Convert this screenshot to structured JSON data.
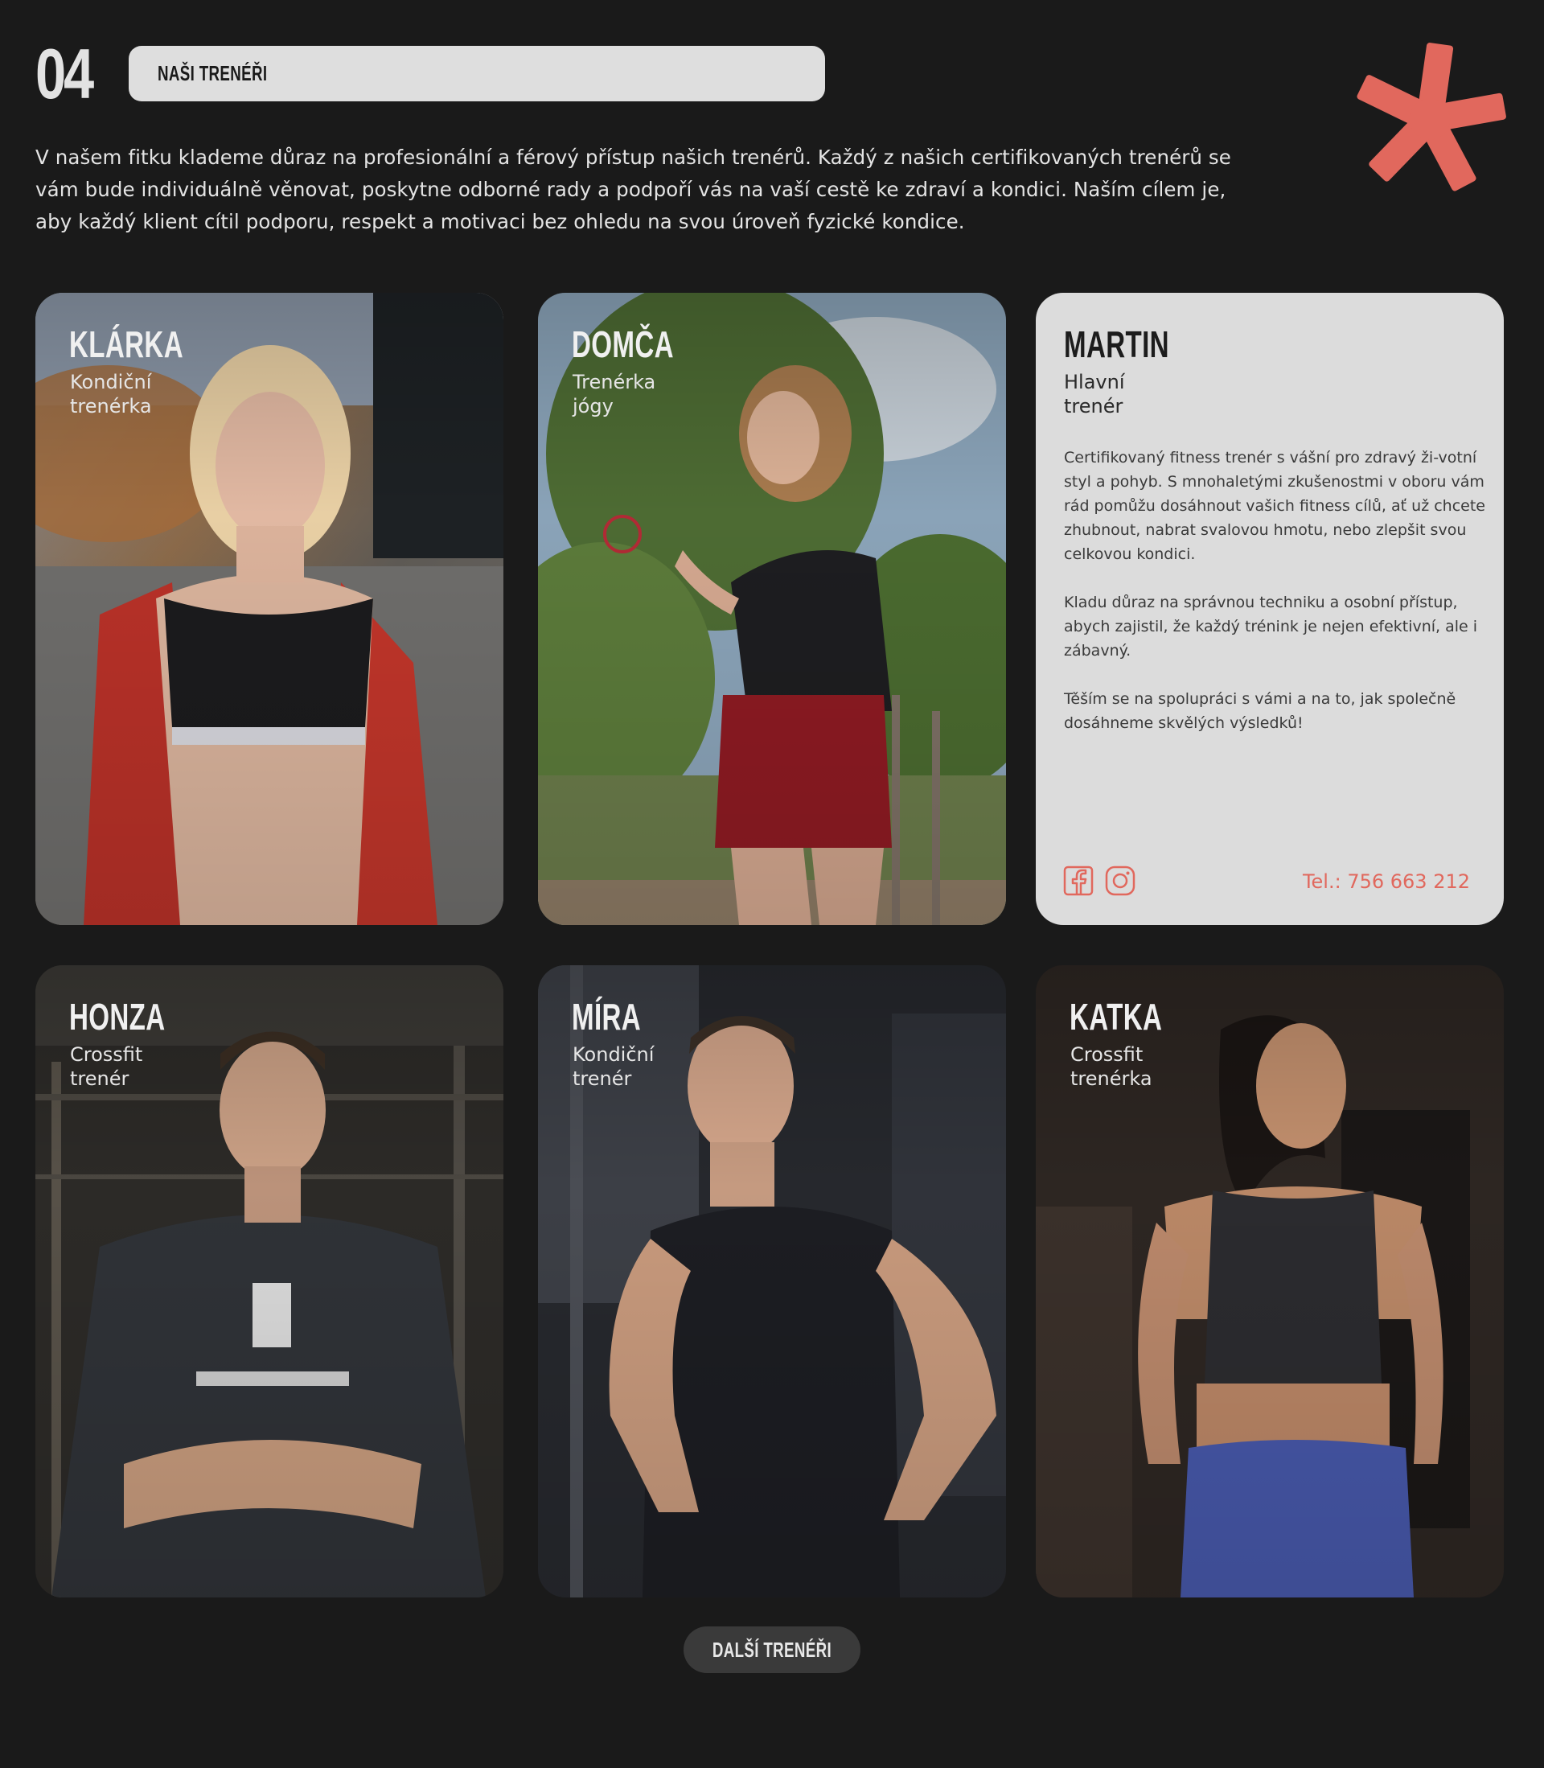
{
  "section": {
    "number": "04",
    "title": "NAŠI TRENÉŘI",
    "intro": "V našem fitku klademe důraz na profesionální a férový přístup našich trenérů. Každý z našich certifikovaných trenérů se vám bude individuálně věnovat, poskytne odborné rady a podpoří vás na vaší cestě ke zdraví a kondici. Naším cílem je, aby každý klient cítil podporu, respekt a motivaci bez ohledu na svou úroveň fyzické kondice."
  },
  "colors": {
    "background": "#1a1a1a",
    "accent": "#e1685d",
    "pill": "#dedede",
    "card_light": "#dcdcdc"
  },
  "trainers": [
    {
      "name": "KLÁRKA",
      "role": "Kondiční trenérka"
    },
    {
      "name": "DOMČA",
      "role": "Trenérka jógy"
    },
    {
      "name": "MARTIN",
      "role": "Hlavní trenér",
      "bio": [
        "Certifikovaný fitness trenér s vášní pro zdravý ži-votní styl a pohyb. S mnohaletými zkušenostmi v oboru vám rád pomůžu dosáhnout vašich fitness cílů, ať už chcete zhubnout, nabrat svalovou hmotu, nebo zlepšit svou celkovou kondici.",
        "Kladu důraz na správnou techniku a osobní přístup, abych zajistil, že každý trénink je nejen efektivní, ale i zábavný.",
        "Těším se na spolupráci s vámi a na to, jak společně dosáhneme skvělých výsledků!"
      ],
      "phone": "Tel.: 756 663 212",
      "socials": [
        "facebook-icon",
        "instagram-icon"
      ]
    },
    {
      "name": "HONZA",
      "role": "Crossfit trenér"
    },
    {
      "name": "MÍRA",
      "role": "Kondiční trenér"
    },
    {
      "name": "KATKA",
      "role": "Crossfit trenérka"
    }
  ],
  "more_button": "DALŠÍ TRENÉŘI"
}
